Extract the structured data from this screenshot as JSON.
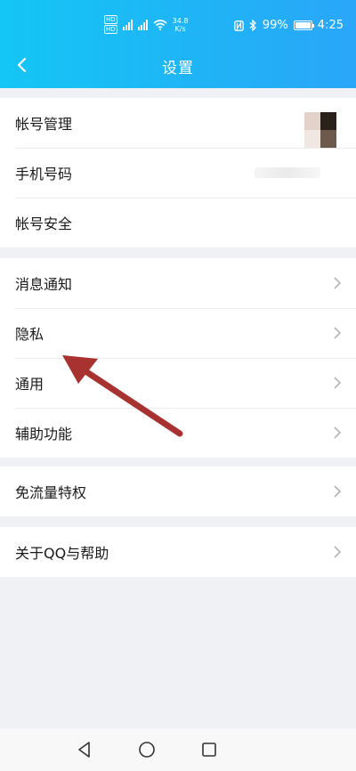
{
  "status_bar": {
    "network_speed_value": "34.8",
    "network_speed_unit": "K/s",
    "battery_percent": "99%",
    "time": "4:25",
    "hd_labels": [
      "HD",
      "HD"
    ]
  },
  "header": {
    "title": "设置",
    "back_icon": "chevron-left-icon"
  },
  "groups": [
    {
      "items": [
        {
          "label": "帐号管理",
          "trailing": "avatar"
        },
        {
          "label": "手机号码",
          "trailing": "blurred-value"
        },
        {
          "label": "帐号安全",
          "trailing": "none"
        }
      ]
    },
    {
      "items": [
        {
          "label": "消息通知",
          "trailing": "chevron-right-icon"
        },
        {
          "label": "隐私",
          "trailing": "chevron-right-icon"
        },
        {
          "label": "通用",
          "trailing": "chevron-right-icon"
        },
        {
          "label": "辅助功能",
          "trailing": "chevron-right-icon"
        }
      ]
    },
    {
      "items": [
        {
          "label": "免流量特权",
          "trailing": "chevron-right-icon"
        }
      ]
    },
    {
      "items": [
        {
          "label": "关于QQ与帮助",
          "trailing": "chevron-right-icon"
        }
      ]
    }
  ],
  "annotation": {
    "icon": "red-arrow-icon",
    "color": "#a8322f"
  },
  "nav_bar": {
    "icons": [
      "back-triangle-icon",
      "home-circle-icon",
      "recents-square-icon"
    ]
  },
  "colors": {
    "header_start": "#14c6f5",
    "header_end": "#2aa6f8",
    "background": "#eff1f5"
  }
}
